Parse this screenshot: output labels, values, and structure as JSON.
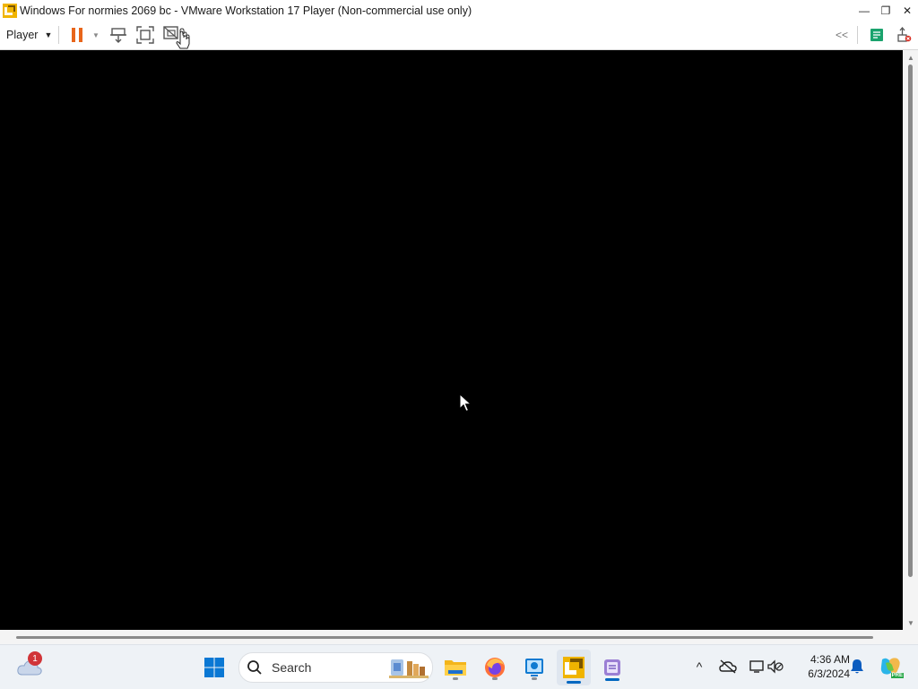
{
  "window": {
    "title": "Windows For normies 2069 bc - VMware Workstation 17 Player (Non-commercial use only)",
    "controls": {
      "minimize": "—",
      "restore": "❐",
      "close": "✕"
    }
  },
  "toolbar": {
    "player_menu_label": "Player",
    "player_menu_caret": "▼",
    "pause_dropdown_caret": "▼",
    "unity_toggle_label": "<<",
    "icons": [
      "pause-icon",
      "send-ctrl-alt-del-icon",
      "fullscreen-icon",
      "unity-icon",
      "message-log-icon",
      "removable-devices-icon"
    ],
    "accent_color": "#e8651a"
  },
  "vm_screen": {
    "background": "#000000",
    "state": "blank"
  },
  "scrollbars": {
    "up_arrow": "▲",
    "down_arrow": "▼"
  },
  "taskbar": {
    "weather_badge": "1",
    "search_placeholder": "Search",
    "pinned_apps": [
      "start-icon",
      "file-explorer-icon",
      "firefox-icon",
      "quick-assist-icon",
      "vmware-player-icon",
      "notepad-icon"
    ],
    "tray": {
      "overflow_chevron": "^",
      "time": "4:36 AM",
      "date": "6/3/2024",
      "copilot_badge": "PRE"
    },
    "accent_color": "#0067c0"
  }
}
